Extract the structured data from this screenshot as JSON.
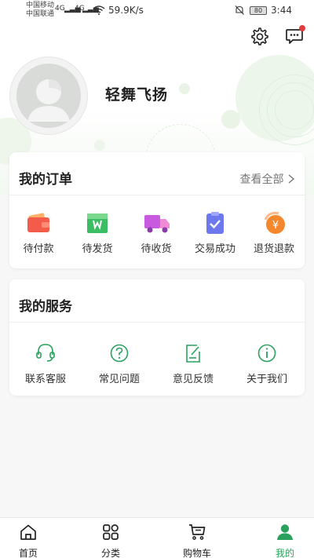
{
  "status_bar": {
    "carrier_1": "中国移动",
    "carrier_2": "中国联通",
    "signal_1": "4G",
    "signal_2": "4G",
    "net_speed": "59.9K/s",
    "battery": "80",
    "time": "3:44"
  },
  "profile": {
    "username": "轻舞飞扬"
  },
  "orders": {
    "title": "我的订单",
    "view_all": "查看全部",
    "items": [
      {
        "label": "待付款",
        "icon": "wallet-icon"
      },
      {
        "label": "待发货",
        "icon": "package-icon"
      },
      {
        "label": "待收货",
        "icon": "truck-icon"
      },
      {
        "label": "交易成功",
        "icon": "clipboard-check-icon"
      },
      {
        "label": "退货退款",
        "icon": "refund-yen-icon"
      }
    ]
  },
  "services": {
    "title": "我的服务",
    "items": [
      {
        "label": "联系客服",
        "icon": "headset-icon"
      },
      {
        "label": "常见问题",
        "icon": "question-icon"
      },
      {
        "label": "意见反馈",
        "icon": "feedback-icon"
      },
      {
        "label": "关于我们",
        "icon": "info-icon"
      }
    ]
  },
  "tabbar": {
    "items": [
      {
        "label": "首页",
        "icon": "home-icon"
      },
      {
        "label": "分类",
        "icon": "category-icon"
      },
      {
        "label": "购物车",
        "icon": "cart-icon"
      },
      {
        "label": "我的",
        "icon": "user-icon"
      }
    ],
    "active": "我的"
  },
  "colors": {
    "accent": "#2aa15c",
    "notification": "#e43b3b"
  }
}
